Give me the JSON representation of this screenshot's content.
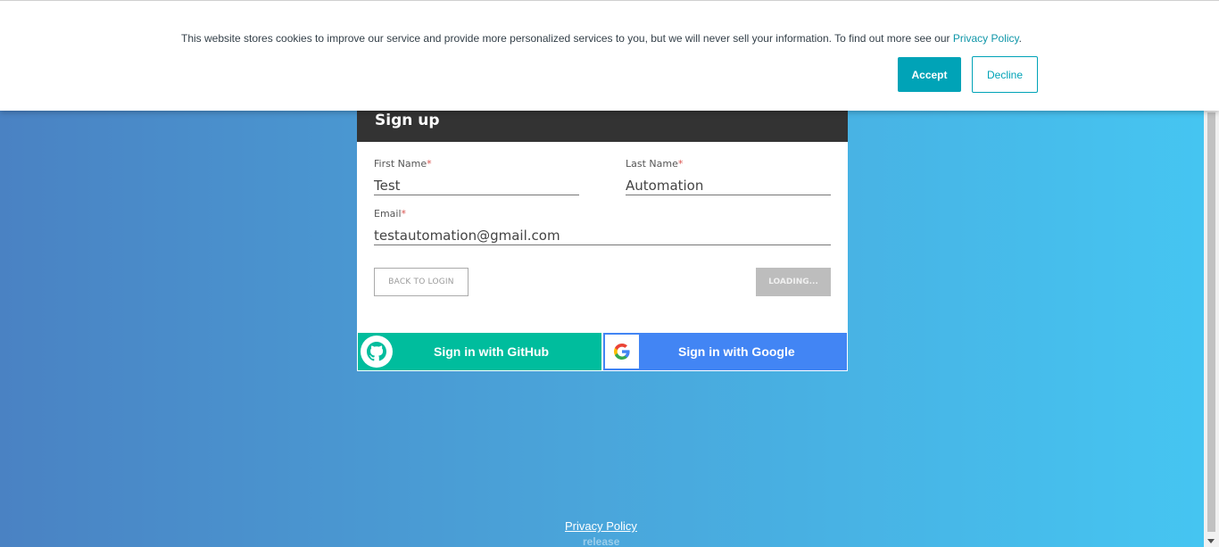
{
  "cookie_banner": {
    "message": "This website stores cookies to improve our service and provide more personalized services to you, but we will never sell your information. To find out more see our ",
    "privacy_link": "Privacy Policy",
    "period": ".",
    "accept_label": "Accept",
    "decline_label": "Decline",
    "accent_color": "#00a3b7"
  },
  "signup": {
    "title": "Sign up",
    "first_name": {
      "label": "First Name",
      "required": "*",
      "value": "Test"
    },
    "last_name": {
      "label": "Last Name",
      "required": "*",
      "value": "Automation"
    },
    "email": {
      "label": "Email",
      "required": "*",
      "value": "testautomation@gmail.com"
    },
    "back_label": "BACK TO LOGIN",
    "submit_label": "LOADING...",
    "github_label": "Sign in with GitHub",
    "google_label": "Sign in with Google",
    "github_icon": "github-icon",
    "google_icon": "google-icon",
    "github_color": "#00bd9d",
    "google_color": "#4285f4"
  },
  "footer": {
    "privacy_link": "Privacy Policy",
    "release": "release"
  }
}
